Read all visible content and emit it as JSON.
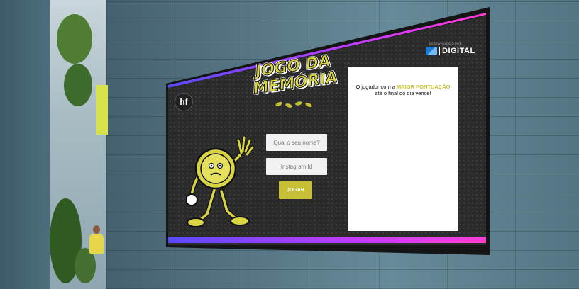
{
  "brand": {
    "logo_text": "hf"
  },
  "game": {
    "title_line1": "JOGO DA",
    "title_line2": "MEMÓRIA"
  },
  "sponsor": {
    "developed_by": "DESENVOLVIDO POR",
    "name": "DIGITAL"
  },
  "form": {
    "name_placeholder": "Qual o seu nome?",
    "instagram_placeholder": "Instagram Id",
    "play_label": "JOGAR"
  },
  "leaderboard": {
    "text_before": "O jogador com a ",
    "highlight": "MAIOR PONTUAÇÃO",
    "text_after": " até o final do dia vence!"
  },
  "colors": {
    "accent_yellow": "#c7bf36",
    "stripe_start": "#5a4bff",
    "stripe_end": "#ff3bd2",
    "screen_bg": "#2b2b2b"
  },
  "icons": {
    "mascot": "coin-mascot-icon",
    "hf_logo": "hf-logo-icon",
    "digital_logo": "digital-logo-icon",
    "leaves": "leaves-decoration-icon"
  }
}
